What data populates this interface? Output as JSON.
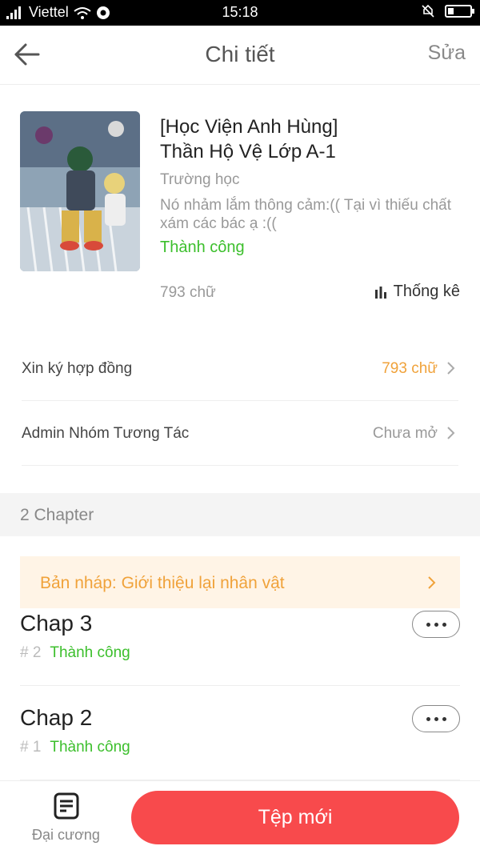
{
  "status_bar": {
    "carrier": "Viettel",
    "time": "15:18",
    "battery_level": 0.25
  },
  "header": {
    "title": "Chi tiết",
    "edit_label": "Sửa"
  },
  "book": {
    "title_line1": "[Học Viện Anh Hùng]",
    "title_line2": "Thần Hộ Vệ Lớp A-1",
    "genre": "Trường học",
    "description": "Nó nhảm lắm thông cảm:(( Tại vì thiếu chất xám các bác ạ :((",
    "status": "Thành công",
    "word_count": "793 chữ",
    "stats_label": "Thống kê"
  },
  "settings": [
    {
      "label": "Xin ký hợp đồng",
      "value": "793 chữ",
      "value_color": "#f0a23a"
    },
    {
      "label": "Admin Nhóm Tương Tác",
      "value": "Chưa mở",
      "value_color": "#999999"
    }
  ],
  "chapter_section": {
    "label": "2 Chapter"
  },
  "draft": {
    "label": "Bản nháp: Giới thiệu lại nhân vật"
  },
  "chapters": [
    {
      "name": "Chap 3",
      "number": "# 2",
      "status": "Thành công"
    },
    {
      "name": "Chap 2",
      "number": "# 1",
      "status": "Thành công"
    }
  ],
  "bottom": {
    "outline_label": "Đại cương",
    "new_button_label": "Tệp mới"
  },
  "colors": {
    "accent_red": "#f84a4c",
    "success_green": "#3cbf2c",
    "warning_orange": "#f0a23a"
  }
}
